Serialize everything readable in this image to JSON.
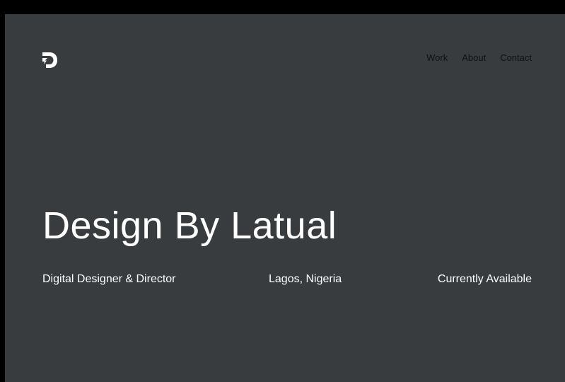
{
  "header": {
    "logo_icon": "d-monogram-logo-icon",
    "nav": {
      "work": "Work",
      "about": "About",
      "contact": "Contact"
    }
  },
  "hero": {
    "title": "Design By Latual",
    "role": "Digital Designer & Director",
    "location": "Lagos, Nigeria",
    "status": "Currently Available"
  },
  "colors": {
    "page_background": "#383c3f",
    "outer_background": "#000000",
    "text_primary": "#ffffff",
    "nav_text": "#0f1112"
  }
}
